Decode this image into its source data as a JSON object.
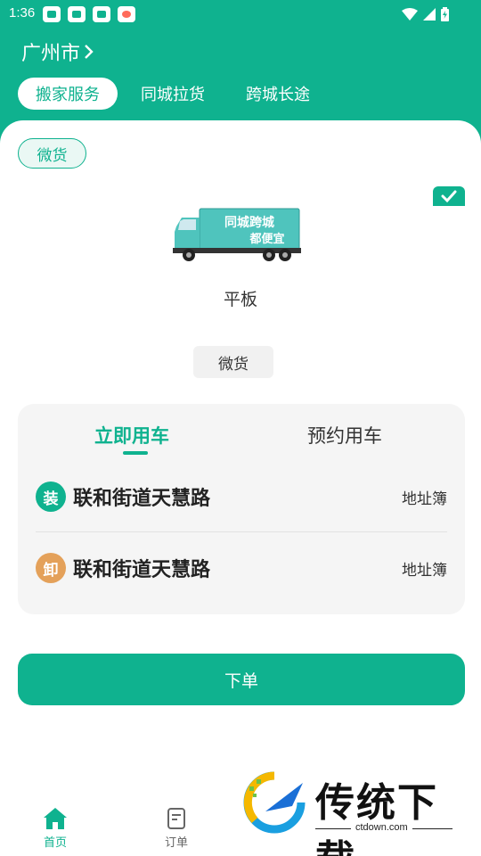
{
  "status_bar": {
    "time": "1:36"
  },
  "header": {
    "city": "广州市",
    "tabs": [
      {
        "label": "搬家服务",
        "active": true
      },
      {
        "label": "同城拉货",
        "active": false
      },
      {
        "label": "跨城长途",
        "active": false
      }
    ]
  },
  "vehicle": {
    "category_chip": "微货",
    "name": "平板",
    "truck_banner_line1": "同城跨城",
    "truck_banner_line2": "都便宜",
    "type_chip": "微货"
  },
  "booking": {
    "tabs": [
      {
        "label": "立即用车",
        "active": true
      },
      {
        "label": "预约用车",
        "active": false
      }
    ],
    "load": {
      "badge": "装",
      "address": "联和街道天慧路",
      "book_label": "地址簿"
    },
    "unload": {
      "badge": "卸",
      "address": "联和街道天慧路",
      "book_label": "地址簿"
    }
  },
  "order_button": "下单",
  "bottom_nav": [
    {
      "label": "首页",
      "active": true
    },
    {
      "label": "订单",
      "active": false
    }
  ],
  "watermark": {
    "brand": "传统下载",
    "url": "ctdown.com"
  },
  "colors": {
    "primary": "#0fb28f",
    "unload": "#e4a15a"
  }
}
